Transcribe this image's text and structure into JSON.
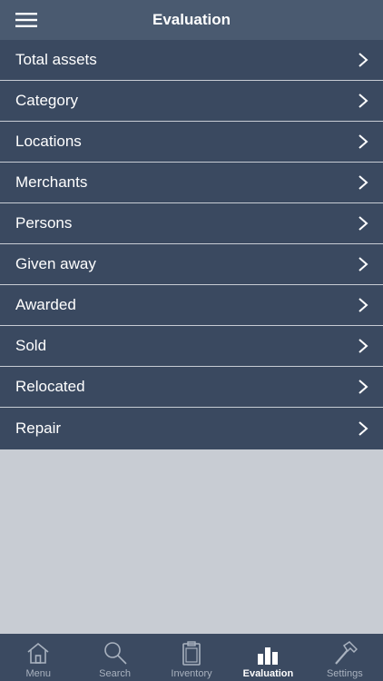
{
  "header": {
    "title": "Evaluation"
  },
  "evaluation_list": [
    {
      "label": "Total assets"
    },
    {
      "label": "Category"
    },
    {
      "label": "Locations"
    },
    {
      "label": "Merchants"
    },
    {
      "label": "Persons"
    },
    {
      "label": "Given away"
    },
    {
      "label": "Awarded"
    },
    {
      "label": "Sold"
    },
    {
      "label": "Relocated"
    },
    {
      "label": "Repair"
    }
  ],
  "tabbar": {
    "tabs": [
      {
        "label": "Menu",
        "icon": "home-icon"
      },
      {
        "label": "Search",
        "icon": "search-icon"
      },
      {
        "label": "Inventory",
        "icon": "clipboard-icon"
      },
      {
        "label": "Evaluation",
        "icon": "bar-chart-icon"
      },
      {
        "label": "Settings",
        "icon": "hammer-icon"
      }
    ],
    "active_tab": "Evaluation"
  },
  "colors": {
    "header_bg": "#4a5a70",
    "list_bg": "#3a4960",
    "page_bg": "#c8ccd3",
    "tabbar_bg": "#3b4a61",
    "divider": "#c7ccd4",
    "inactive_tab": "#a9b2bf",
    "active_tab": "#ffffff"
  }
}
